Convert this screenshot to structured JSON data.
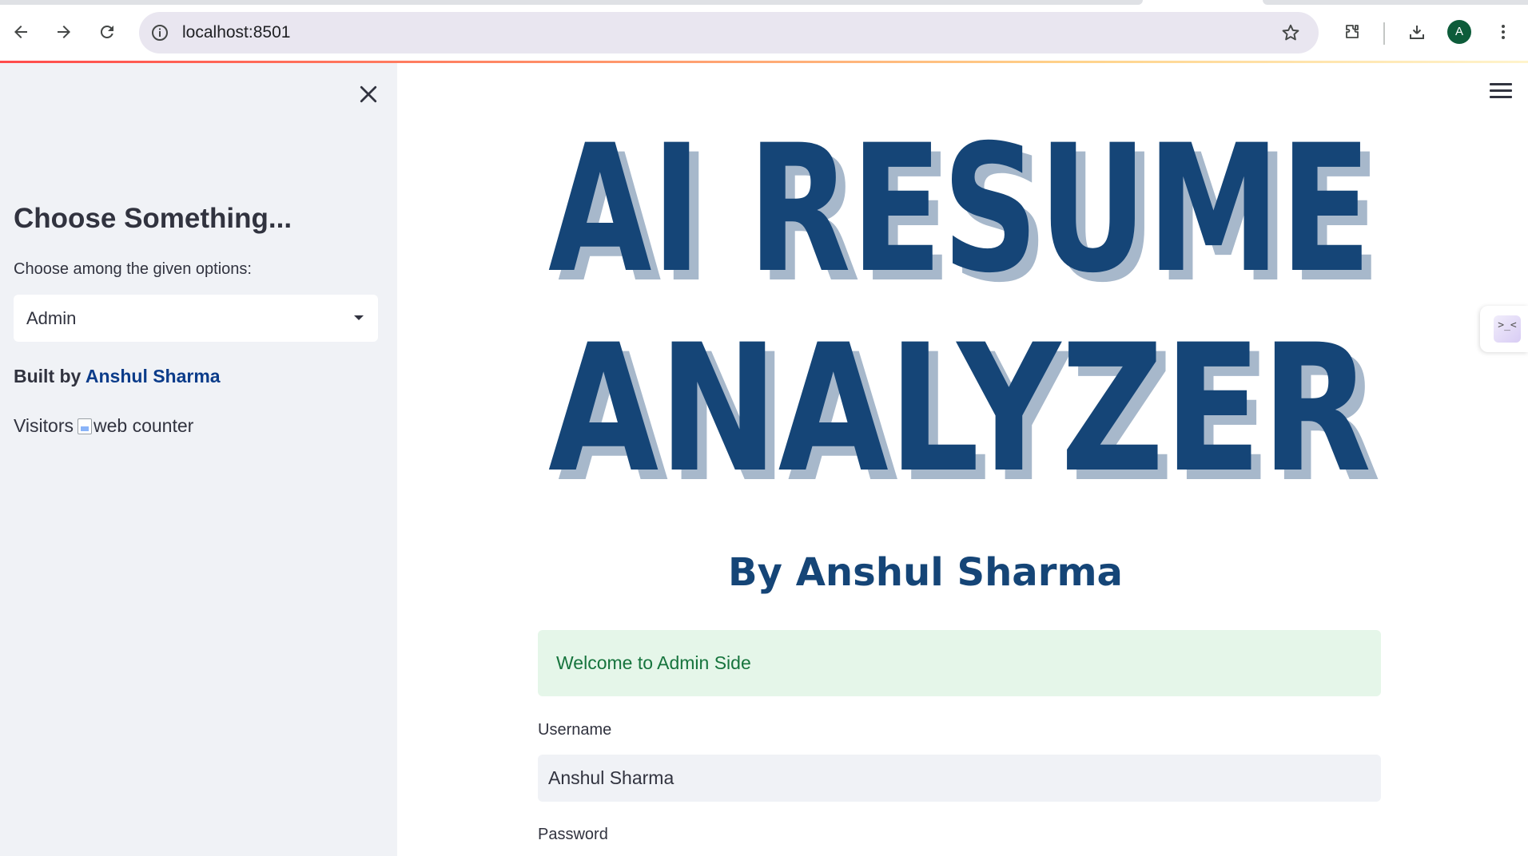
{
  "browser": {
    "url": "localhost:8501",
    "profile_initial": "A",
    "icons": [
      "back-icon",
      "forward-icon",
      "reload-icon",
      "info-icon",
      "star-icon",
      "extensions-icon",
      "download-icon",
      "kebab-menu-icon"
    ]
  },
  "sidebar": {
    "heading": "Choose Something...",
    "select_label": "Choose among the given options:",
    "select_value": "Admin",
    "built_prefix": "Built by",
    "built_author": "Anshul Sharma",
    "visitors_label": "Visitors",
    "counter_alt": "web counter"
  },
  "main": {
    "banner": {
      "line1": "AI RESUME",
      "line2": "ANALYZER",
      "byline": "By Anshul Sharma"
    },
    "alert_text": "Welcome to Admin Side",
    "username_label": "Username",
    "username_value": "Anshul Sharma",
    "password_label": "Password",
    "side_widget_glyph": ">_<"
  },
  "colors": {
    "banner_text": "#154577",
    "banner_shadow": "#a7b8cb",
    "sidebar_bg": "#f0f2f6",
    "alert_bg": "#e5f6e9",
    "alert_text": "#16743d",
    "link": "#0b3c8a"
  }
}
